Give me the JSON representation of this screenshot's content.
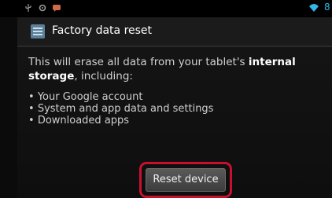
{
  "statusbar": {
    "icons": [
      "usb-icon",
      "gear-icon",
      "message-icon",
      "wifi-icon"
    ],
    "time_fragment": "8"
  },
  "title": {
    "icon": "settings-app-icon",
    "text": "Factory data reset"
  },
  "message": {
    "before_bold": "This will erase all data from your tablet's ",
    "bold": "internal storage",
    "after_bold": ", including:"
  },
  "items": [
    "Your Google account",
    "System and app data and settings",
    "Downloaded apps"
  ],
  "button": {
    "label": "Reset device"
  },
  "colors": {
    "accent": "#33b5e5",
    "highlight": "#c8102e"
  }
}
